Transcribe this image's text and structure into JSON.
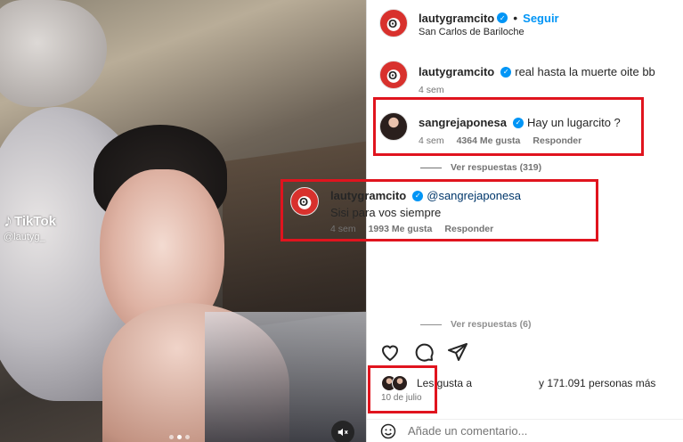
{
  "video": {
    "watermark_brand": "TikTok",
    "watermark_user": "@lautyg_",
    "mute_icon": "speaker-muted-icon"
  },
  "post": {
    "author": "lautygramcito",
    "separator": "•",
    "follow_label": "Seguir",
    "location": "San Carlos de Bariloche"
  },
  "comments": [
    {
      "user": "lautygramcito",
      "text": "real hasta la muerte oite bb",
      "age": "4 sem"
    },
    {
      "user": "sangrejaponesa",
      "text": "Hay un lugarcito ?",
      "age": "4 sem",
      "likes": "4364 Me gusta",
      "reply_label": "Responder",
      "view_replies": "Ver respuestas (319)"
    },
    {
      "user": "lautygramcito",
      "mention": "@sangrejaponesa",
      "text": "Sisi para vos siempre",
      "age": "4 sem",
      "likes": "1993 Me gusta",
      "reply_label": "Responder"
    }
  ],
  "hidden_replies": "Ver respuestas (6)",
  "likes_summary": {
    "prefix": "Les gusta a",
    "suffix": "y 171.091 personas más"
  },
  "post_date": "10 de julio",
  "comment_box": {
    "placeholder": "Añade un comentario..."
  },
  "colors": {
    "accent": "#0095f6",
    "highlight": "#e0141e"
  }
}
